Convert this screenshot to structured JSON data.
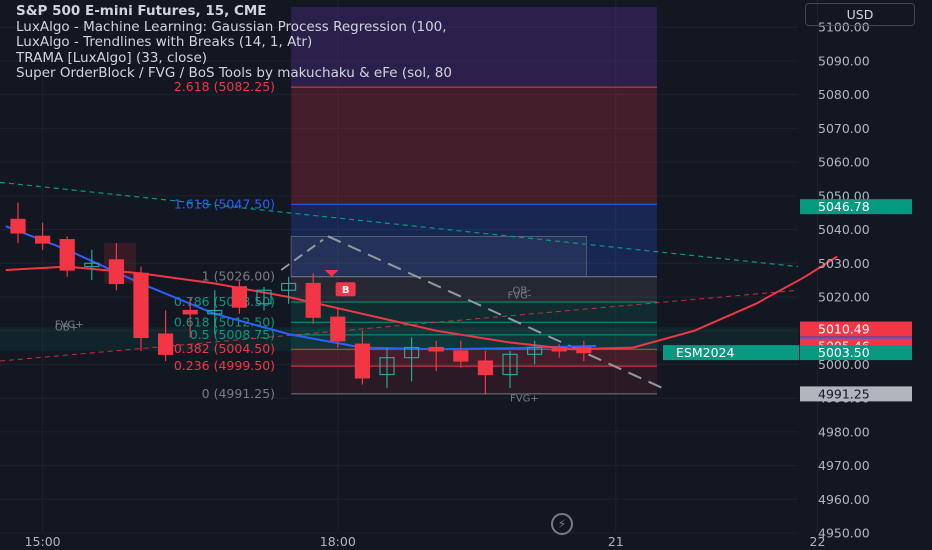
{
  "legend": {
    "symbol": "S&P 500 E-mini Futures, 15, CME",
    "lines": [
      "LuxAlgo - Machine Learning: Gaussian Process Regression (100, ",
      "LuxAlgo - Trendlines with Breaks (14, 1, Atr)",
      "TRAMA [LuxAlgo] (33, close)",
      "Super OrderBlock / FVG / BoS Tools by makuchaku & eFe (sol, 80"
    ]
  },
  "currency": "USD",
  "colors": {
    "background": "#131722",
    "up": "#26a69a",
    "down": "#f23645",
    "fib_red": "#f23645",
    "fib_blue": "#2962ff",
    "fib_gray": "#787b86",
    "gpr": "#f23645",
    "trama": "#2962ff"
  },
  "chart_data": {
    "type": "candlestick",
    "y_axis": {
      "min": 4950,
      "max": 5106,
      "ticks": [
        5100.0,
        5090.0,
        5080.0,
        5070.0,
        5060.0,
        5050.0,
        5040.0,
        5030.0,
        5020.0,
        5010.0,
        5000.0,
        4990.0,
        4980.0,
        4970.0,
        4960.0,
        4950.0
      ]
    },
    "x_axis": {
      "ticks": [
        {
          "label": "15:00",
          "bar": 1
        },
        {
          "label": "18:00",
          "bar": 13
        },
        {
          "label": "21",
          "bar": 24.3
        },
        {
          "label": "22",
          "bar": 32.5
        }
      ]
    },
    "candles": [
      {
        "o": 5043,
        "h": 5048,
        "l": 5036,
        "c": 5039
      },
      {
        "o": 5038,
        "h": 5042,
        "l": 5034,
        "c": 5036
      },
      {
        "o": 5037,
        "h": 5038,
        "l": 5026,
        "c": 5028
      },
      {
        "o": 5029,
        "h": 5034,
        "l": 5025,
        "c": 5030
      },
      {
        "o": 5031,
        "h": 5036,
        "l": 5022,
        "c": 5024
      },
      {
        "o": 5027,
        "h": 5029,
        "l": 5004,
        "c": 5008
      },
      {
        "o": 5009,
        "h": 5016,
        "l": 5001,
        "c": 5003
      },
      {
        "o": 5016,
        "h": 5020,
        "l": 5008,
        "c": 5015
      },
      {
        "o": 5015,
        "h": 5022,
        "l": 5009,
        "c": 5016
      },
      {
        "o": 5023,
        "h": 5025,
        "l": 5015,
        "c": 5017
      },
      {
        "o": 5018,
        "h": 5023,
        "l": 5016,
        "c": 5022
      },
      {
        "o": 5022,
        "h": 5026,
        "l": 5018,
        "c": 5024
      },
      {
        "o": 5024,
        "h": 5027,
        "l": 5012,
        "c": 5014
      },
      {
        "o": 5014,
        "h": 5017,
        "l": 5005,
        "c": 5007
      },
      {
        "o": 5006,
        "h": 5010,
        "l": 4994,
        "c": 4996
      },
      {
        "o": 4997,
        "h": 5005,
        "l": 4993,
        "c": 5002
      },
      {
        "o": 5002,
        "h": 5008,
        "l": 4995,
        "c": 5005
      },
      {
        "o": 5005,
        "h": 5007,
        "l": 4998,
        "c": 5004
      },
      {
        "o": 5004,
        "h": 5007,
        "l": 4999,
        "c": 5001
      },
      {
        "o": 5001,
        "h": 5004,
        "l": 4991,
        "c": 4997
      },
      {
        "o": 4997,
        "h": 5004,
        "l": 4993,
        "c": 5003
      },
      {
        "o": 5003,
        "h": 5007,
        "l": 5000,
        "c": 5005
      },
      {
        "o": 5005,
        "h": 5006,
        "l": 5002,
        "c": 5004
      },
      {
        "o": 5005,
        "h": 5007,
        "l": 5001,
        "c": 5003.5
      }
    ],
    "fib_levels": [
      {
        "ratio": "2.618",
        "price": 5082.25,
        "text": "2.618 (5082.25)",
        "color": "#f23645"
      },
      {
        "ratio": "1.618",
        "price": 5047.5,
        "text": "1.618 (5047.50)",
        "color": "#2962ff"
      },
      {
        "ratio": "1",
        "price": 5026.0,
        "text": "1 (5026.00)",
        "color": "#787b86"
      },
      {
        "ratio": "0.786",
        "price": 5018.5,
        "text": "0.786 (5018.50)",
        "color": "#089981"
      },
      {
        "ratio": "0.618",
        "price": 5012.5,
        "text": "0.618 (5012.50)",
        "color": "#089981"
      },
      {
        "ratio": "0.5",
        "price": 5008.75,
        "text": "0.5 (5008.75)",
        "color": "#089981"
      },
      {
        "ratio": "0.382",
        "price": 5004.5,
        "text": "0.382 (5004.50)",
        "color": "#f23645"
      },
      {
        "ratio": "0.236",
        "price": 4999.5,
        "text": "0.236 (4999.50)",
        "color": "#f23645"
      },
      {
        "ratio": "0",
        "price": 4991.25,
        "text": "0 (4991.25)",
        "color": "#787b86"
      }
    ],
    "chart_labels": [
      {
        "text": "FVG+",
        "price": 5011,
        "bar": 1.5
      },
      {
        "text": "OB-",
        "price": 5021,
        "bar": 20.1
      },
      {
        "text": "FVG-",
        "price": 5019.6,
        "bar": 19.9
      },
      {
        "text": "OB+",
        "price": 5010,
        "bar": 1.5
      },
      {
        "text": "FVG+",
        "price": 4989,
        "bar": 20.0
      }
    ],
    "breakout_label": {
      "text": "B",
      "price": 5022,
      "bar": 12.75
    },
    "price_labels": [
      {
        "text": "5046.78",
        "price": 5046.78,
        "color": "#089981"
      },
      {
        "text": "5010.49",
        "price": 5010.49,
        "color": "#f23645"
      },
      {
        "text": "5006.00",
        "price": 5006.0,
        "color": "#2962ff"
      },
      {
        "text": "5005.46",
        "price": 5005.46,
        "color": "#f23645"
      },
      {
        "text": "5003.50",
        "price": 5003.5,
        "color": "#089981"
      },
      {
        "text": "4991.25",
        "price": 4991.25,
        "color": "#b2b5be"
      }
    ],
    "symbol_tag": {
      "text": "ESM2024",
      "price": 5003.5
    },
    "trama": [
      [
        -0.5,
        5041
      ],
      [
        2,
        5034
      ],
      [
        5,
        5024
      ],
      [
        8,
        5015
      ],
      [
        11,
        5009
      ],
      [
        14,
        5005
      ],
      [
        17,
        5004.5
      ],
      [
        20,
        5004.8
      ],
      [
        23.5,
        5005.5
      ]
    ],
    "gpr": [
      [
        -0.5,
        5028
      ],
      [
        2,
        5029
      ],
      [
        5,
        5027
      ],
      [
        8,
        5024
      ],
      [
        11,
        5020
      ],
      [
        14,
        5015
      ],
      [
        17,
        5010
      ],
      [
        20,
        5006.5
      ],
      [
        22.5,
        5004.5
      ],
      [
        25,
        5005
      ],
      [
        27.5,
        5010
      ],
      [
        30,
        5018
      ],
      [
        32,
        5026
      ],
      [
        33.3,
        5032
      ]
    ]
  }
}
